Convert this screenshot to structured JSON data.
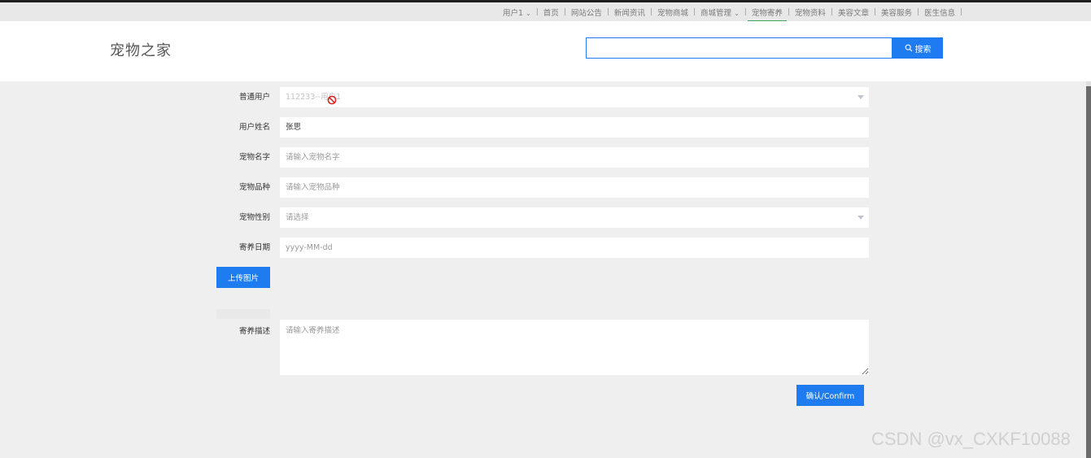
{
  "nav": {
    "user_menu": "用户1",
    "items": [
      "首页",
      "网站公告",
      "新闻资讯",
      "宠物商城",
      "商城管理",
      "宠物寄养",
      "宠物资料",
      "美容文章",
      "美容服务",
      "医生信息"
    ],
    "active_index": 5,
    "dropdown_index": 4
  },
  "header": {
    "brand": "宠物之家",
    "search_value": "",
    "search_button": "搜索"
  },
  "form": {
    "fields": [
      {
        "label": "普通用户",
        "value": "112233--用户1",
        "kind": "select-disabled"
      },
      {
        "label": "用户姓名",
        "value": "张思",
        "kind": "text-value"
      },
      {
        "label": "宠物名字",
        "placeholder": "请输入宠物名字",
        "kind": "text"
      },
      {
        "label": "宠物品种",
        "placeholder": "请输入宠物品种",
        "kind": "text"
      },
      {
        "label": "宠物性别",
        "placeholder": "请选择",
        "kind": "select"
      },
      {
        "label": "寄养日期",
        "placeholder": "yyyy-MM-dd",
        "kind": "date"
      }
    ],
    "upload_button": "上传图片",
    "description_label": "寄养描述",
    "description_placeholder": "请输入寄养描述",
    "confirm_button": "确认/Confirm"
  },
  "watermark": "CSDN @vx_CXKF10088",
  "colors": {
    "primary": "#1e7bf0",
    "active_underline": "#3fa85e"
  }
}
